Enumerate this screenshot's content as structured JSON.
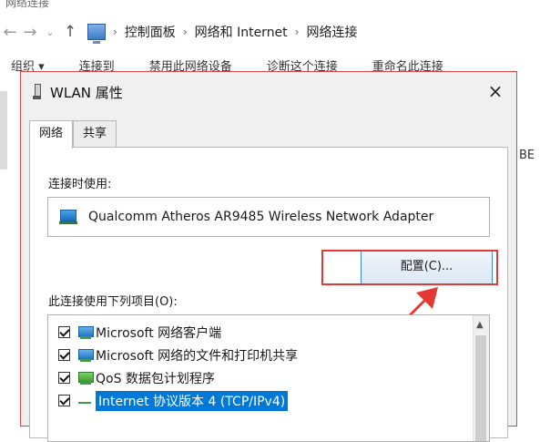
{
  "explorer": {
    "window_title": "网络连接",
    "breadcrumbs": [
      "控制面板",
      "网络和 Internet",
      "网络连接"
    ],
    "toolbar": [
      "组织 ▾",
      "连接到",
      "禁用此网络设备",
      "诊断这个连接",
      "重命名此连接"
    ],
    "side_text": "BE"
  },
  "dialog": {
    "title": "WLAN 属性",
    "close_glyph": "×",
    "tabs": [
      {
        "label": "网络",
        "active": true
      },
      {
        "label": "共享",
        "active": false
      }
    ],
    "connect_using_label": "连接时使用:",
    "adapter_name": "Qualcomm Atheros AR9485 Wireless Network Adapter",
    "configure_button": "配置(C)...",
    "items_label": "此连接使用下列项目(O):",
    "items": [
      {
        "label": "Microsoft 网络客户端",
        "checked": true,
        "icon": "network-client-icon"
      },
      {
        "label": "Microsoft 网络的文件和打印机共享",
        "checked": true,
        "icon": "file-share-icon"
      },
      {
        "label": "QoS 数据包计划程序",
        "checked": true,
        "icon": "qos-icon"
      },
      {
        "label": "Internet 协议版本 4 (TCP/IPv4)",
        "checked": true,
        "icon": "protocol-icon",
        "selected": true
      }
    ]
  },
  "colors": {
    "highlight": "#e53935",
    "selection": "#0078d7",
    "button_border": "#3c8bd7"
  }
}
